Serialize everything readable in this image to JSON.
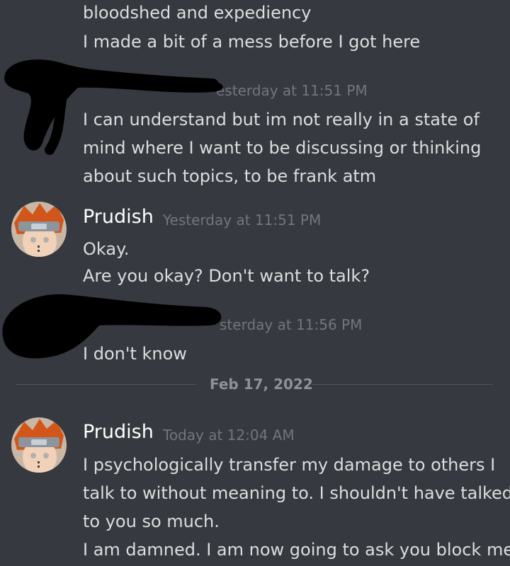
{
  "messages": [
    {
      "lines": [
        "bloodshed and expediency",
        "I made a bit of a mess before I got here"
      ]
    },
    {
      "timestamp": "esterday at 11:51 PM",
      "lines": [
        "I can understand but im not really in a state of",
        "mind where I want to be discussing or thinking",
        "about such topics, to be frank atm"
      ]
    },
    {
      "author": "Prudish",
      "timestamp": "Yesterday at 11:51 PM",
      "lines": [
        "Okay.",
        "Are you okay? Don't want to talk?"
      ]
    },
    {
      "timestamp": "sterday at 11:56 PM",
      "lines": [
        "I don't know"
      ]
    },
    {
      "author": "Prudish",
      "timestamp": "Today at 12:04 AM",
      "lines": [
        "I psychologically transfer my damage to others I",
        "talk to without meaning to. I shouldn't have talked",
        "to you so much.",
        "I am damned. I am now going to ask you block me"
      ]
    }
  ],
  "date_divider": "Feb 17, 2022",
  "colors": {
    "background": "#36393f",
    "message_text": "#dcddde",
    "author_text": "#ffffff",
    "timestamp_text": "#72767d",
    "divider": "#4f545c",
    "redaction": "#000000"
  },
  "icons": {
    "avatar": "anime-character-avatar-icon"
  }
}
